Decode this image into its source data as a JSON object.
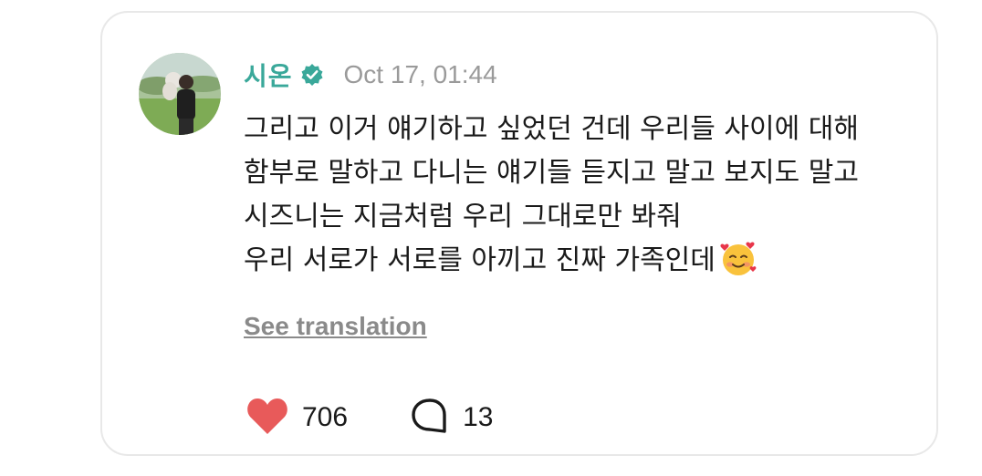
{
  "post": {
    "author": {
      "name": "시온",
      "verified_icon": "verified-badge-icon",
      "avatar": "profile-photo"
    },
    "timestamp": "Oct 17, 01:44",
    "menu_icon": "more-vertical-icon",
    "text_lines": [
      "그리고 이거 얘기하고 싶었던 건데 우리들 사이에 대해",
      "함부로 말하고 다니는 얘기들 듣지고 말고 보지도 말고",
      "시즈니는 지금처럼 우리 그대로만 봐줘",
      "우리 서로가 서로를 아끼고 진짜 가족인데"
    ],
    "emoji": "smiling-face-with-hearts",
    "see_translation_label": "See translation",
    "likes": {
      "icon": "heart-icon",
      "count": "706",
      "color": "#e85a5a"
    },
    "comments": {
      "icon": "comment-bubble-icon",
      "count": "13"
    }
  },
  "colors": {
    "author_name": "#3aa89a",
    "verified_badge": "#3aa89a",
    "timestamp": "#9a9a9a",
    "heart": "#e85a5a",
    "card_border": "#e8e8e8"
  }
}
